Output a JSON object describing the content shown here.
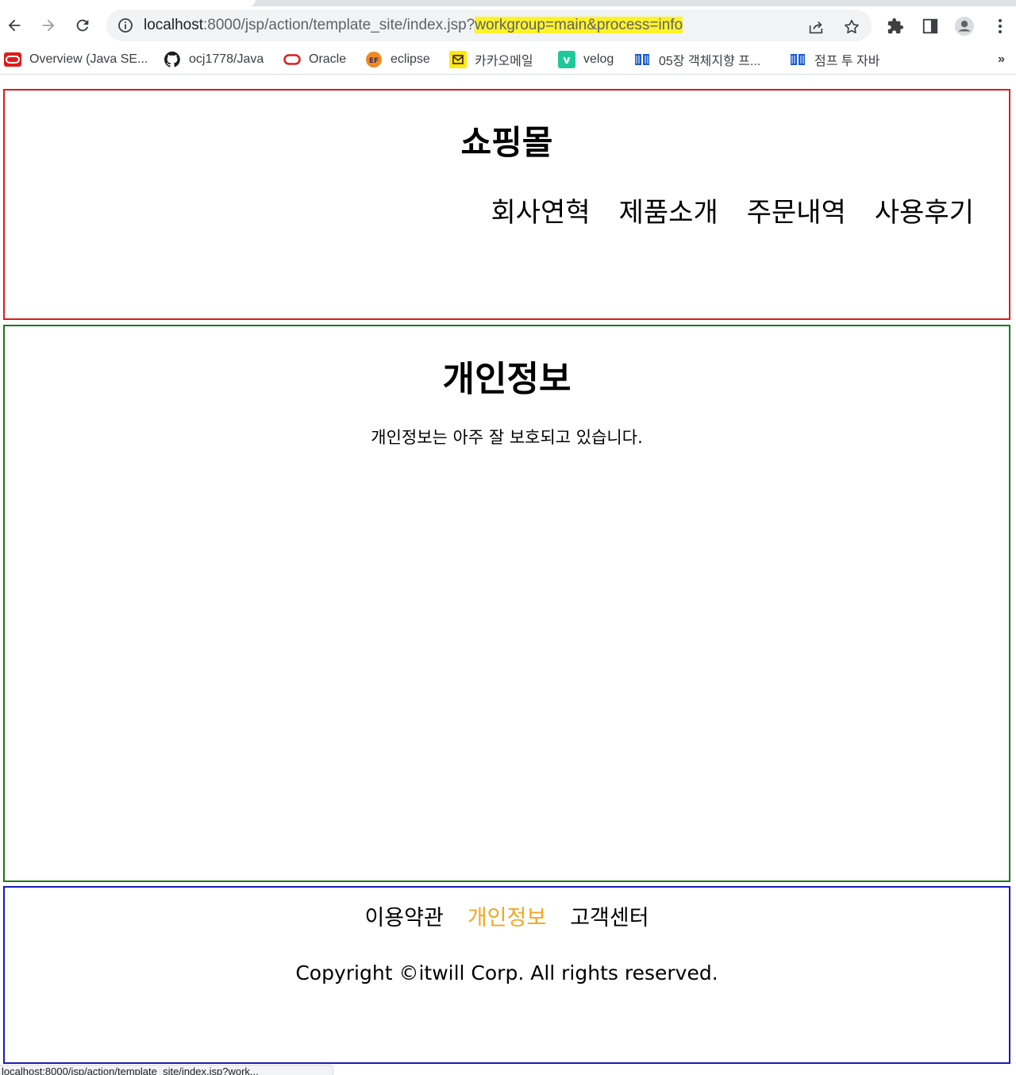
{
  "browser": {
    "url_host": "localhost",
    "url_path": ":8000/jsp/action/template_site/index.jsp?",
    "url_query_highlighted": "workgroup=main&process=info",
    "highlight_color": "#fff22a",
    "bookmarks": [
      {
        "label": "Overview (Java SE...",
        "icon": "oracle-java-icon"
      },
      {
        "label": "ocj1778/Java",
        "icon": "github-icon"
      },
      {
        "label": "Oracle",
        "icon": "oracle-icon"
      },
      {
        "label": "eclipse",
        "icon": "eclipse-icon"
      },
      {
        "label": "카카오메일",
        "icon": "kakao-mail-icon"
      },
      {
        "label": "velog",
        "icon": "velog-icon"
      },
      {
        "label": "05장 객체지향 프...",
        "icon": "book-icon"
      },
      {
        "label": "점프 투 자바",
        "icon": "book-icon"
      }
    ],
    "bookmarks_more": "»",
    "status_url": "localhost:8000/jsp/action/template_site/index.jsp?work..."
  },
  "header": {
    "title": "쇼핑몰",
    "border_color": "#e01b1b",
    "menu": [
      "회사연혁",
      "제품소개",
      "주문내역",
      "사용후기"
    ]
  },
  "main": {
    "title": "개인정보",
    "text": "개인정보는 아주 잘 보호되고 있습니다.",
    "border_color": "#1a7a1a"
  },
  "footer": {
    "menu": [
      "이용약관",
      "개인정보",
      "고객센터"
    ],
    "active_item": "개인정보",
    "active_color": "#f5a623",
    "copyright": "Copyright ©itwill Corp. All rights reserved.",
    "border_color": "#1a1ab8"
  }
}
